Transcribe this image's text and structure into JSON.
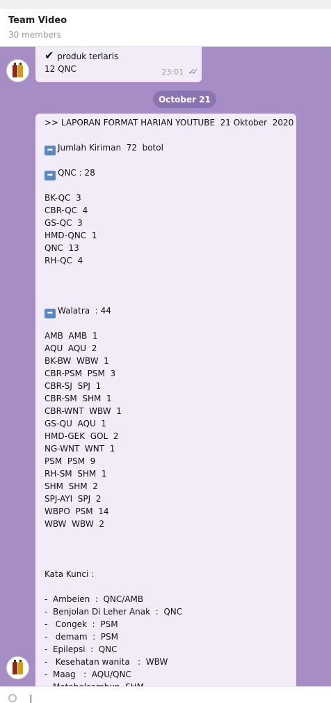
{
  "header": {
    "title": "Team Video",
    "subtitle": "30 members"
  },
  "message1": {
    "check_icon": "✔",
    "line1": "produk terlaris",
    "line2": "12 QNC",
    "time": "23:01",
    "status_icon": "✓✓"
  },
  "date_divider": "October 21",
  "message2": {
    "lines": [
      ">> LAPORAN FORMAT HARIAN YOUTUBE  21 Oktober  2020",
      "",
      "Jumlah Kiriman  72  botol",
      "",
      "QNC : 28",
      "",
      "BK-QC  3",
      "CBR-QC  4",
      "GS-QC  3",
      "HMD-QNC  1",
      "QNC  13",
      "RH-QC  4",
      "",
      "",
      "",
      "Walatra  : 44",
      "",
      "AMB  AMB  1",
      "AQU  AQU  2",
      "BK-BW  WBW  1",
      "CBR-PSM  PSM  3",
      "CBR-SJ  SPJ  1",
      "CBR-SM  SHM  1",
      "CBR-WNT  WBW  1",
      "GS-QU  AQU  1",
      "HMD-GEK  GOL  2",
      "NG-WNT  WNT  1",
      "PSM  PSM  9",
      "RH-SM  SHM  1",
      "SHM  SHM  2",
      "SPJ-AYI  SPJ  2",
      "WBPO  PSM  14",
      "WBW  WBW  2",
      "",
      "",
      "",
      "Kata Kunci :",
      "",
      "-  Ambeien  :  QNC/AMB",
      "-  Benjolan Di Leher Anak  :  QNC",
      "-   Congek  :  PSM",
      "-   demam  :  PSM",
      "-  Epilepsi  :  QNC",
      "-   Kesehatan wanita   :  WBW",
      "-  Maag   :  AQU/QNC",
      "-  Matabelcambun  SHM"
    ],
    "arrow_line_indices": [
      2,
      4,
      15
    ],
    "arrow_icon": "➡"
  },
  "avatar_icon": "group-avatar-bottles",
  "colors": {
    "chat_bg": "#a68dc5",
    "bubble_bg": "#f1ecf8",
    "date_pill": "#8c73b2",
    "arrow_box": "#5a88bf"
  }
}
